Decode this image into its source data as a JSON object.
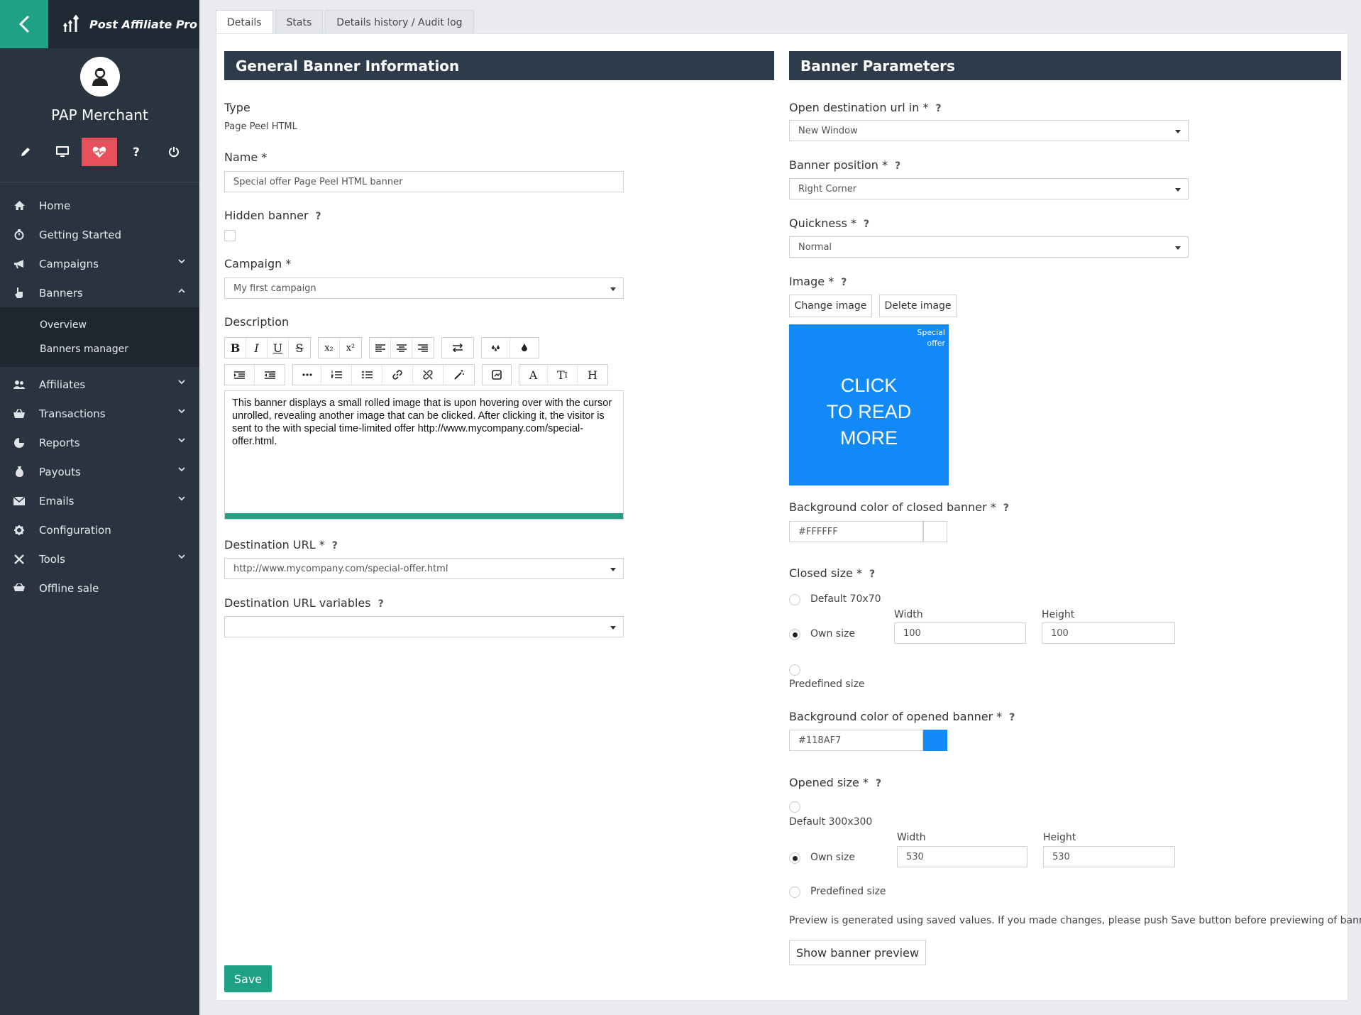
{
  "app": {
    "brand": "Post Affiliate Pro",
    "user": "PAP Merchant"
  },
  "sidebar": {
    "quick_icons": [
      "pencil-icon",
      "monitor-icon",
      "heartbeat-icon",
      "help-icon",
      "power-icon"
    ],
    "items": [
      {
        "label": "Home",
        "icon": "home-icon"
      },
      {
        "label": "Getting Started",
        "icon": "stopwatch-icon"
      },
      {
        "label": "Campaigns",
        "icon": "megaphone-icon"
      },
      {
        "label": "Banners",
        "icon": "pointer-hand-icon"
      },
      {
        "label": "Affiliates",
        "icon": "users-icon"
      },
      {
        "label": "Transactions",
        "icon": "basket-icon"
      },
      {
        "label": "Reports",
        "icon": "pie-chart-icon"
      },
      {
        "label": "Payouts",
        "icon": "money-bag-icon"
      },
      {
        "label": "Emails",
        "icon": "envelope-icon"
      },
      {
        "label": "Configuration",
        "icon": "gear-icon"
      },
      {
        "label": "Tools",
        "icon": "tools-icon"
      },
      {
        "label": "Offline sale",
        "icon": "cart-icon"
      }
    ],
    "banner_sub": [
      "Overview",
      "Banners manager"
    ]
  },
  "tabs": [
    "Details",
    "Stats",
    "Details history / Audit log"
  ],
  "general": {
    "title": "General Banner Information",
    "type_label": "Type",
    "type_value": "Page Peel HTML",
    "name_label": "Name *",
    "name_value": "Special offer Page Peel HTML banner",
    "hidden_label": "Hidden banner",
    "campaign_label": "Campaign *",
    "campaign_value": "My first campaign",
    "description_label": "Description",
    "description_text": "This banner displays a small rolled image that is upon hovering over with the cursor unrolled, revealing another image that can be clicked. After clicking it, the visitor is sent to the with special time-limited offer http://www.mycompany.com/special-offer.html.",
    "dest_url_label": "Destination URL *",
    "dest_url_value": "http://www.mycompany.com/special-offer.html",
    "dest_vars_label": "Destination URL variables",
    "dest_vars_value": "",
    "save_label": "Save",
    "help": "?"
  },
  "params": {
    "title": "Banner Parameters",
    "open_label": "Open destination url in *",
    "open_value": "New Window",
    "position_label": "Banner position *",
    "position_value": "Right Corner",
    "quickness_label": "Quickness *",
    "quickness_value": "Normal",
    "image_label": "Image *",
    "change_image": "Change image",
    "delete_image": "Delete image",
    "image_corner": "Special offer",
    "image_text_1": "CLICK",
    "image_text_2": "TO READ",
    "image_text_3": "MORE",
    "bg_closed_label": "Background color of closed banner *",
    "bg_closed_value": "#FFFFFF",
    "closed_size_label": "Closed size *",
    "closed_default": "Default 70x70",
    "own_size": "Own size",
    "predefined_size": "Predefined size",
    "width_label": "Width",
    "height_label": "Height",
    "closed_width": "100",
    "closed_height": "100",
    "bg_opened_label": "Background color of opened banner *",
    "bg_opened_value": "#118AF7",
    "opened_size_label": "Opened size *",
    "opened_default": "Default 300x300",
    "opened_width": "530",
    "opened_height": "530",
    "preview_note": "Preview is generated using saved values. If you made changes, please push Save button before previewing of banner.",
    "preview_button": "Show banner preview"
  },
  "colors": {
    "accent": "#1fa185",
    "sidebar": "#2a3440",
    "header": "#2d3b4b",
    "banner_blue": "#118af7",
    "active_icon": "#e8505b"
  }
}
